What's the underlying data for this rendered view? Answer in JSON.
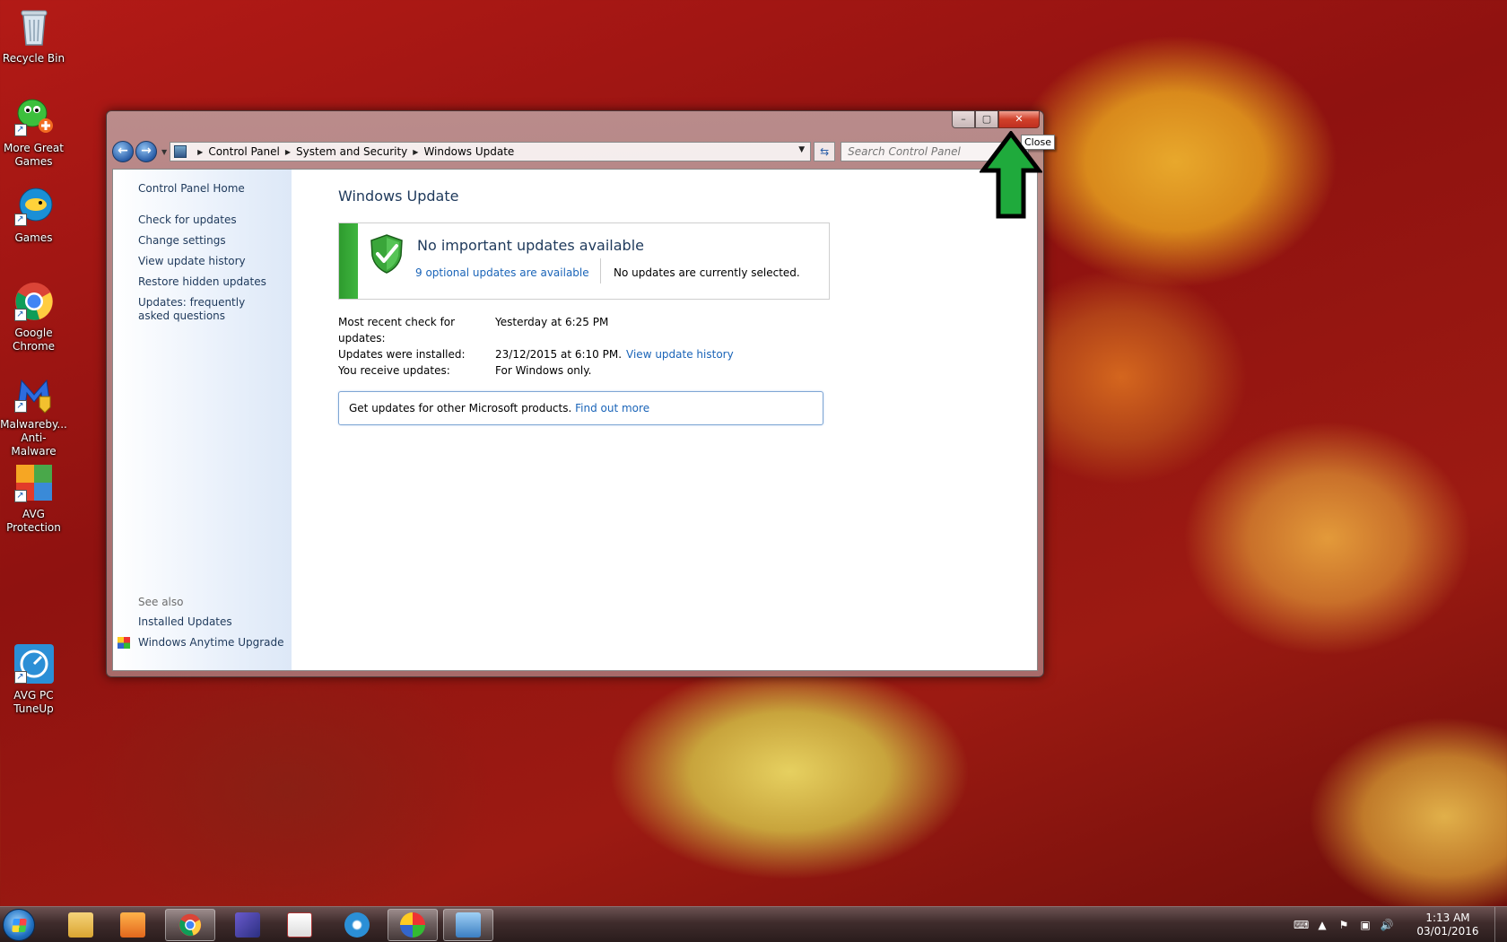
{
  "desktop": {
    "icons": [
      {
        "label": "Recycle Bin"
      },
      {
        "label": "More Great Games"
      },
      {
        "label": "Games"
      },
      {
        "label": "Google Chrome"
      },
      {
        "label": "Malwareby... Anti-Malware"
      },
      {
        "label": "AVG Protection"
      },
      {
        "label": "AVG PC TuneUp"
      }
    ]
  },
  "window": {
    "caption": {
      "minimize": "–",
      "maximize": "▢",
      "close": "✕"
    },
    "tooltip": "Close",
    "nav": {
      "back": "←",
      "forward": "→"
    },
    "breadcrumb": [
      "Control Panel",
      "System and Security",
      "Windows Update"
    ],
    "search_placeholder": "Search Control Panel",
    "sidebar": {
      "home": "Control Panel Home",
      "links": [
        "Check for updates",
        "Change settings",
        "View update history",
        "Restore hidden updates",
        "Updates: frequently asked questions"
      ],
      "see_also_label": "See also",
      "see_also": [
        "Installed Updates",
        "Windows Anytime Upgrade"
      ]
    },
    "main": {
      "title": "Windows Update",
      "status_title": "No important updates available",
      "optional_link": "9 optional updates are available",
      "none_selected": "No updates are currently selected.",
      "info": [
        {
          "key": "Most recent check for updates:",
          "value": "Yesterday at 6:25 PM",
          "link": ""
        },
        {
          "key": "Updates were installed:",
          "value": "23/12/2015 at 6:10 PM.",
          "link": "View update history"
        },
        {
          "key": "You receive updates:",
          "value": "For Windows only.",
          "link": ""
        }
      ],
      "other_text": "Get updates for other Microsoft products.",
      "other_link": "Find out more"
    }
  },
  "taskbar": {
    "clock_time": "1:13 AM",
    "clock_date": "03/01/2016"
  },
  "colors": {
    "accent_link": "#1a64b8",
    "title": "#1e395b",
    "status_green": "#2e9b2e",
    "annotation_arrow": "#1faa3c"
  }
}
